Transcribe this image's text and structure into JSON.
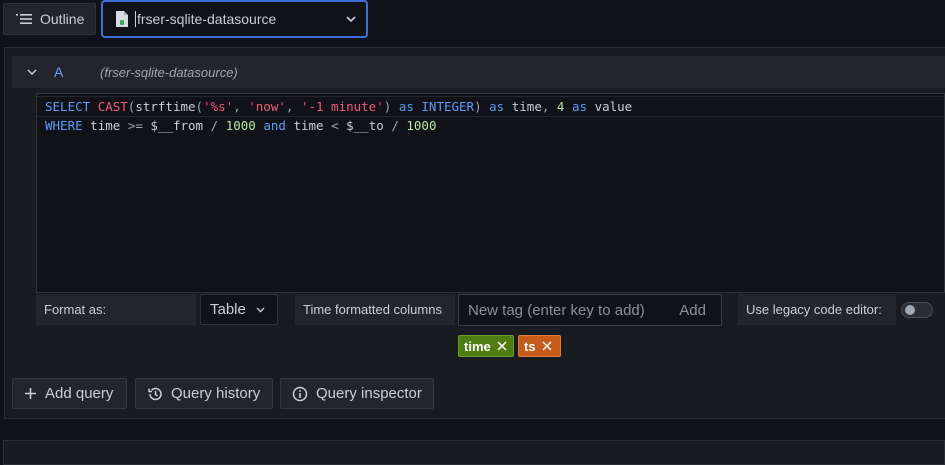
{
  "toolbar": {
    "outline_label": "Outline",
    "datasource_value": "frser-sqlite-datasource"
  },
  "query": {
    "ref_id": "A",
    "datasource_label": "(frser-sqlite-datasource)",
    "sql_lines": [
      "SELECT CAST(strftime('%s', 'now', '-1 minute') as INTEGER) as time, 4 as value",
      "WHERE time >= $__from / 1000 and time < $__to / 1000"
    ]
  },
  "options": {
    "format_label": "Format as:",
    "format_value": "Table",
    "time_columns_label": "Time formatted columns",
    "tag_placeholder": "New tag (enter key to add)",
    "tag_add_label": "Add",
    "legacy_editor_label": "Use legacy code editor:",
    "legacy_editor_enabled": false,
    "tags": [
      {
        "label": "time",
        "color": "#4f7d12"
      },
      {
        "label": "ts",
        "color": "#c65a1a"
      }
    ]
  },
  "actions": {
    "add_query": "Add query",
    "query_history": "Query history",
    "query_inspector": "Query inspector"
  },
  "colors": {
    "accent_blue": "#3d71d9",
    "keyword": "#5a9cf8",
    "string": "#f05a78",
    "number": "#b5e3a0"
  }
}
